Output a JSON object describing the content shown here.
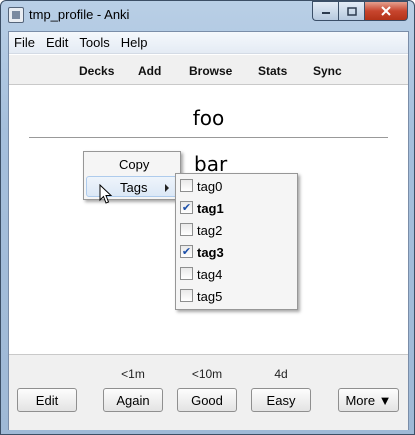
{
  "window": {
    "title": "tmp_profile - Anki"
  },
  "menubar": [
    "File",
    "Edit",
    "Tools",
    "Help"
  ],
  "toolbar": {
    "decks": "Decks",
    "add": "Add",
    "browse": "Browse",
    "stats": "Stats",
    "sync": "Sync"
  },
  "card": {
    "front": "foo",
    "back": "bar"
  },
  "context_menu": {
    "items": [
      "Copy",
      "Tags"
    ],
    "highlighted": "Tags",
    "tags_submenu": [
      {
        "label": "tag0",
        "checked": false
      },
      {
        "label": "tag1",
        "checked": true
      },
      {
        "label": "tag2",
        "checked": false
      },
      {
        "label": "tag3",
        "checked": true
      },
      {
        "label": "tag4",
        "checked": false
      },
      {
        "label": "tag5",
        "checked": false
      }
    ]
  },
  "bottom_bar": {
    "intervals": {
      "again": "<1m",
      "good": "<10m",
      "easy": "4d"
    },
    "buttons": {
      "edit": "Edit",
      "again": "Again",
      "good": "Good",
      "easy": "Easy",
      "more": "More ▼"
    }
  },
  "icons": {
    "minimize": "minimize-icon",
    "maximize": "maximize-icon",
    "close": "close-icon",
    "submenu": "chevron-right-icon",
    "check": "checkmark-icon"
  },
  "colors": {
    "titlebar": "#a5bfdc",
    "close_button": "#c7452e",
    "highlight": "#dce8f6",
    "check": "#1c4fa8"
  }
}
